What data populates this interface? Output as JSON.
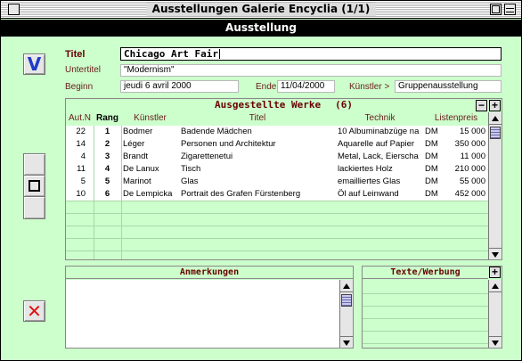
{
  "window": {
    "title": "Ausstellungen Galerie Encyclia (1/1)"
  },
  "header": {
    "title": "Ausstellung"
  },
  "buttons": {
    "ok_label": "V",
    "cancel_label": "✕"
  },
  "form": {
    "titel_label": "Titel",
    "titel_value": "Chicago Art Fair",
    "untertitel_label": "Untertitel",
    "untertitel_value": "\"Modernism\"",
    "beginn_label": "Beginn",
    "beginn_value": "jeudi 6 avril 2000",
    "ende_label": "Ende",
    "ende_value": "11/04/2000",
    "kuenstler_label": "Künstler >",
    "kuenstler_value": "Gruppenausstellung"
  },
  "works": {
    "title": "Ausgestellte Werke",
    "count": "(6)",
    "minus_label": "−",
    "plus_label": "+",
    "columns": [
      "Aut.N",
      "Rang",
      "Künstler",
      "Titel",
      "Technik",
      "Listenpreis"
    ],
    "rows": [
      {
        "autn": "22",
        "rang": "1",
        "kuenstler": "Bodmer",
        "titel": "Badende Mädchen",
        "technik": "10 Albuminabzüge na",
        "currency": "DM",
        "preis": "15 000"
      },
      {
        "autn": "14",
        "rang": "2",
        "kuenstler": "Léger",
        "titel": "Personen und Architektur",
        "technik": "Aquarelle auf Papier",
        "currency": "DM",
        "preis": "350 000"
      },
      {
        "autn": "4",
        "rang": "3",
        "kuenstler": "Brandt",
        "titel": "Zigarettenetui",
        "technik": "Metal, Lack, Eierscha",
        "currency": "DM",
        "preis": "11 000"
      },
      {
        "autn": "11",
        "rang": "4",
        "kuenstler": "De Lanux",
        "titel": "Tisch",
        "technik": "lackiertes Holz",
        "currency": "DM",
        "preis": "210 000"
      },
      {
        "autn": "5",
        "rang": "5",
        "kuenstler": "Marinot",
        "titel": "Glas",
        "technik": "emailliertes Glas",
        "currency": "DM",
        "preis": "55 000"
      },
      {
        "autn": "10",
        "rang": "6",
        "kuenstler": "De Lempicka",
        "titel": "Portrait des Grafen Fürstenberg",
        "technik": "Öl auf Leinwand",
        "currency": "DM",
        "preis": "452 000"
      }
    ]
  },
  "notes": {
    "title": "Anmerkungen",
    "value": ""
  },
  "texts": {
    "title": "Texte/Werbung",
    "plus_label": "+"
  }
}
